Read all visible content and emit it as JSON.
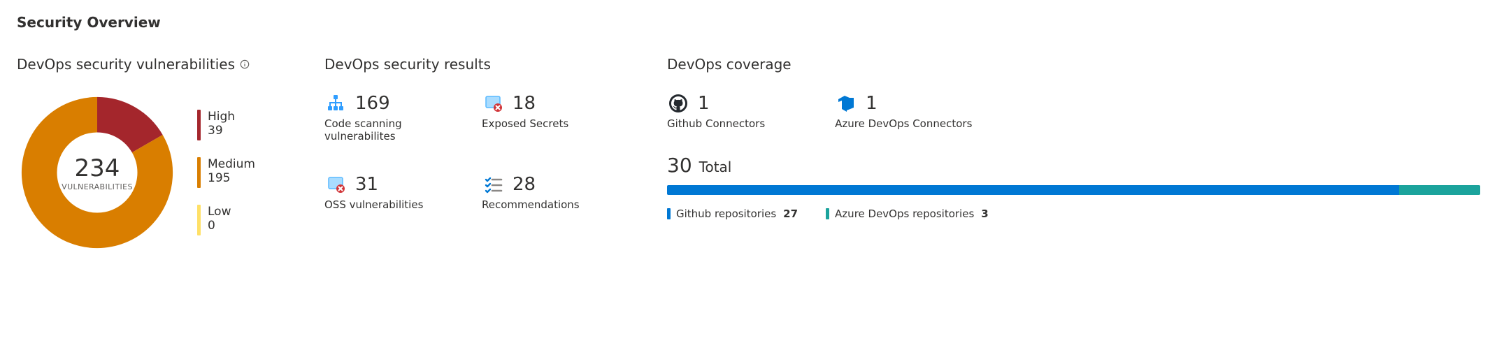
{
  "title": "Security Overview",
  "vuln_panel": {
    "title": "DevOps security vulnerabilities",
    "total": "234",
    "total_label": "VULNERABILITIES",
    "items": [
      {
        "name": "High",
        "value": "39",
        "num": 39,
        "color": "#a4262c"
      },
      {
        "name": "Medium",
        "value": "195",
        "num": 195,
        "color": "#d97e00"
      },
      {
        "name": "Low",
        "value": "0",
        "num": 0,
        "color": "#ffe066"
      }
    ]
  },
  "results_panel": {
    "title": "DevOps security results",
    "items": [
      {
        "label": "Code scanning vulnerabilites",
        "value": "169",
        "icon": "code-scan"
      },
      {
        "label": "Exposed Secrets",
        "value": "18",
        "icon": "secrets"
      },
      {
        "label": "OSS vulnerabilities",
        "value": "31",
        "icon": "oss"
      },
      {
        "label": "Recommendations",
        "value": "28",
        "icon": "recommend"
      }
    ]
  },
  "coverage_panel": {
    "title": "DevOps coverage",
    "connectors": [
      {
        "label": "Github Connectors",
        "value": "1",
        "icon": "github"
      },
      {
        "label": "Azure DevOps Connectors",
        "value": "1",
        "icon": "azdo"
      }
    ],
    "total_value": "30",
    "total_word": "Total",
    "repos": [
      {
        "label": "Github repositories",
        "value": "27",
        "num": 27,
        "color": "#0078d4"
      },
      {
        "label": "Azure DevOps repositories",
        "value": "3",
        "num": 3,
        "color": "#1ba39c"
      }
    ]
  },
  "chart_data": [
    {
      "type": "pie",
      "title": "DevOps security vulnerabilities",
      "categories": [
        "High",
        "Medium",
        "Low"
      ],
      "values": [
        39,
        195,
        0
      ],
      "colors": [
        "#a4262c",
        "#d97e00",
        "#ffe066"
      ],
      "center_value": 234,
      "center_label": "VULNERABILITIES",
      "donut": true
    },
    {
      "type": "bar",
      "title": "DevOps coverage — repositories",
      "stacked": true,
      "series": [
        {
          "name": "Github repositories",
          "values": [
            27
          ],
          "color": "#0078d4"
        },
        {
          "name": "Azure DevOps repositories",
          "values": [
            3
          ],
          "color": "#1ba39c"
        }
      ],
      "total": 30
    }
  ]
}
